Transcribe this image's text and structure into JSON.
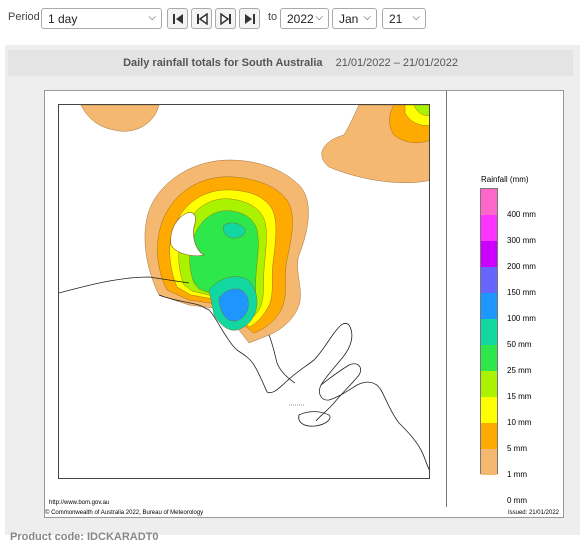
{
  "controls": {
    "period_label": "Period",
    "period_value": "1 day",
    "to_label": "to",
    "year": "2022",
    "month": "Jan",
    "day": "21"
  },
  "header": {
    "title": "Daily rainfall totals for South Australia",
    "date_range": "21/01/2022 – 21/01/2022"
  },
  "legend": {
    "title": "Rainfall (mm)",
    "labels": [
      "400 mm",
      "300 mm",
      "200 mm",
      "150 mm",
      "100 mm",
      "50 mm",
      "25 mm",
      "15 mm",
      "10 mm",
      "5 mm",
      "1 mm",
      "0 mm"
    ],
    "colors": [
      "#ff66cc",
      "#ff33ff",
      "#cc00ff",
      "#6666ff",
      "#1e96ff",
      "#13d7a0",
      "#2ee84b",
      "#aaf200",
      "#ffff00",
      "#ffaa00",
      "#f5b870",
      "#ffffff"
    ]
  },
  "footer": {
    "url": "http://www.bom.gov.au",
    "copyright": "© Commonwealth of Australia 2022, Bureau of Meteorology",
    "issued": "Issued: 21/01/2022"
  },
  "product_code": "Product code: IDCKARADT0"
}
